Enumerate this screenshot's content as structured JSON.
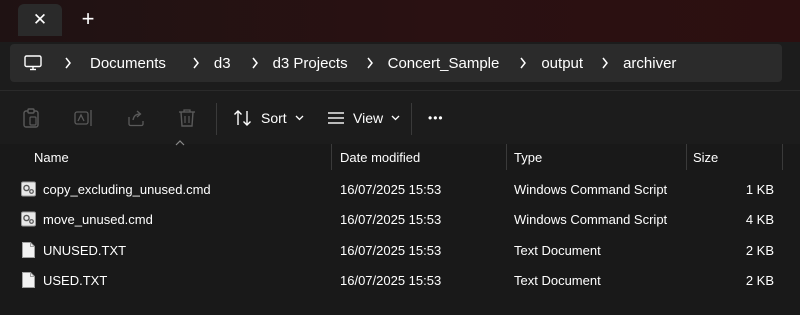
{
  "tabs": {
    "close_label": "✕",
    "add_label": "+"
  },
  "address": {
    "crumbs": [
      "Documents",
      "d3",
      "d3 Projects",
      "Concert_Sample",
      "output",
      "archiver"
    ]
  },
  "toolbar": {
    "sort_label": "Sort",
    "view_label": "View",
    "more_label": "•••"
  },
  "columns": {
    "name": "Name",
    "date": "Date modified",
    "type": "Type",
    "size": "Size"
  },
  "files": [
    {
      "name": "copy_excluding_unused.cmd",
      "date": "16/07/2025 15:53",
      "type": "Windows Command Script",
      "size": "1 KB",
      "icon": "cmd-file-icon"
    },
    {
      "name": "move_unused.cmd",
      "date": "16/07/2025 15:53",
      "type": "Windows Command Script",
      "size": "4 KB",
      "icon": "cmd-file-icon"
    },
    {
      "name": "UNUSED.TXT",
      "date": "16/07/2025 15:53",
      "type": "Text Document",
      "size": "2 KB",
      "icon": "text-file-icon"
    },
    {
      "name": "USED.TXT",
      "date": "16/07/2025 15:53",
      "type": "Text Document",
      "size": "2 KB",
      "icon": "text-file-icon"
    }
  ],
  "colors": {
    "background": "#191919",
    "address_bg": "#2b2b2b",
    "titlebar": "#2a1112",
    "text": "#ffffff",
    "muted": "#8a8a8a"
  }
}
